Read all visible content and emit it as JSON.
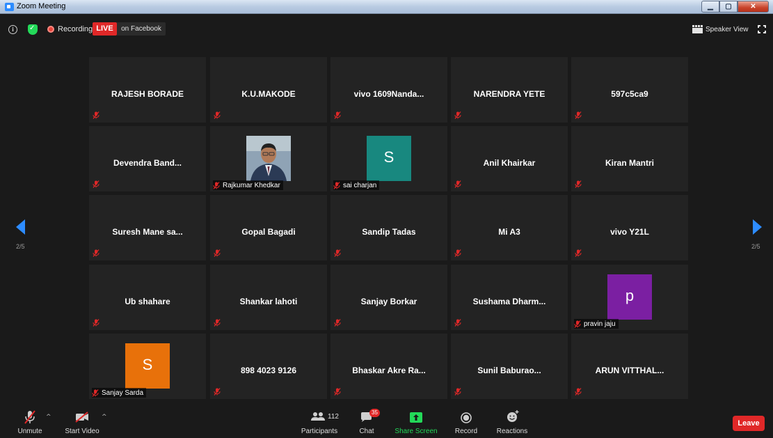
{
  "window": {
    "title": "Zoom Meeting"
  },
  "topbar": {
    "recording_label": "Recording",
    "live_label": "LIVE",
    "live_destination": "on Facebook",
    "view_label": "Speaker View"
  },
  "pagination": {
    "left_page": "2/5",
    "right_page": "2/5"
  },
  "participants_grid": [
    {
      "name": "RAJESH BORADE",
      "muted": true
    },
    {
      "name": "K.U.MAKODE",
      "muted": true
    },
    {
      "name": "vivo  1609Nanda...",
      "muted": true
    },
    {
      "name": "NARENDRA YETE",
      "muted": true
    },
    {
      "name": "597c5ca9",
      "muted": true
    },
    {
      "name": "Devendra  Band...",
      "muted": true
    },
    {
      "name": "Rajkumar Khedkar",
      "muted": true,
      "video": "photo"
    },
    {
      "name": "sai charjan",
      "muted": true,
      "avatar_letter": "S",
      "avatar_color": "#18887f"
    },
    {
      "name": "Anil Khairkar",
      "muted": true
    },
    {
      "name": "Kiran Mantri",
      "muted": true
    },
    {
      "name": "Suresh Mane  sa...",
      "muted": true
    },
    {
      "name": "Gopal Bagadi",
      "muted": true
    },
    {
      "name": "Sandip Tadas",
      "muted": true
    },
    {
      "name": "Mi A3",
      "muted": true
    },
    {
      "name": "vivo Y21L",
      "muted": true
    },
    {
      "name": "Ub shahare",
      "muted": true
    },
    {
      "name": "Shankar lahoti",
      "muted": true
    },
    {
      "name": "Sanjay Borkar",
      "muted": true
    },
    {
      "name": "Sushama  Dharm...",
      "muted": true
    },
    {
      "name": "pravin jaju",
      "muted": true,
      "avatar_letter": "p",
      "avatar_color": "#7b1fa2"
    },
    {
      "name": "Sanjay Sarda",
      "muted": true,
      "avatar_letter": "S",
      "avatar_color": "#e8710a"
    },
    {
      "name": "898 4023 9126",
      "muted": true
    },
    {
      "name": "Bhaskar  Akre  Ra...",
      "muted": true
    },
    {
      "name": "Sunil  Baburao...",
      "muted": true
    },
    {
      "name": "ARUN  VITTHAL...",
      "muted": true
    }
  ],
  "toolbar": {
    "unmute_label": "Unmute",
    "start_video_label": "Start Video",
    "participants_label": "Participants",
    "participants_count": "112",
    "chat_label": "Chat",
    "chat_badge": "35",
    "share_screen_label": "Share Screen",
    "record_label": "Record",
    "reactions_label": "Reactions",
    "leave_label": "Leave"
  },
  "colors": {
    "accent_blue": "#2d8cff",
    "live_red": "#e02828",
    "share_green": "#23d959",
    "muted_red": "#e02828"
  }
}
